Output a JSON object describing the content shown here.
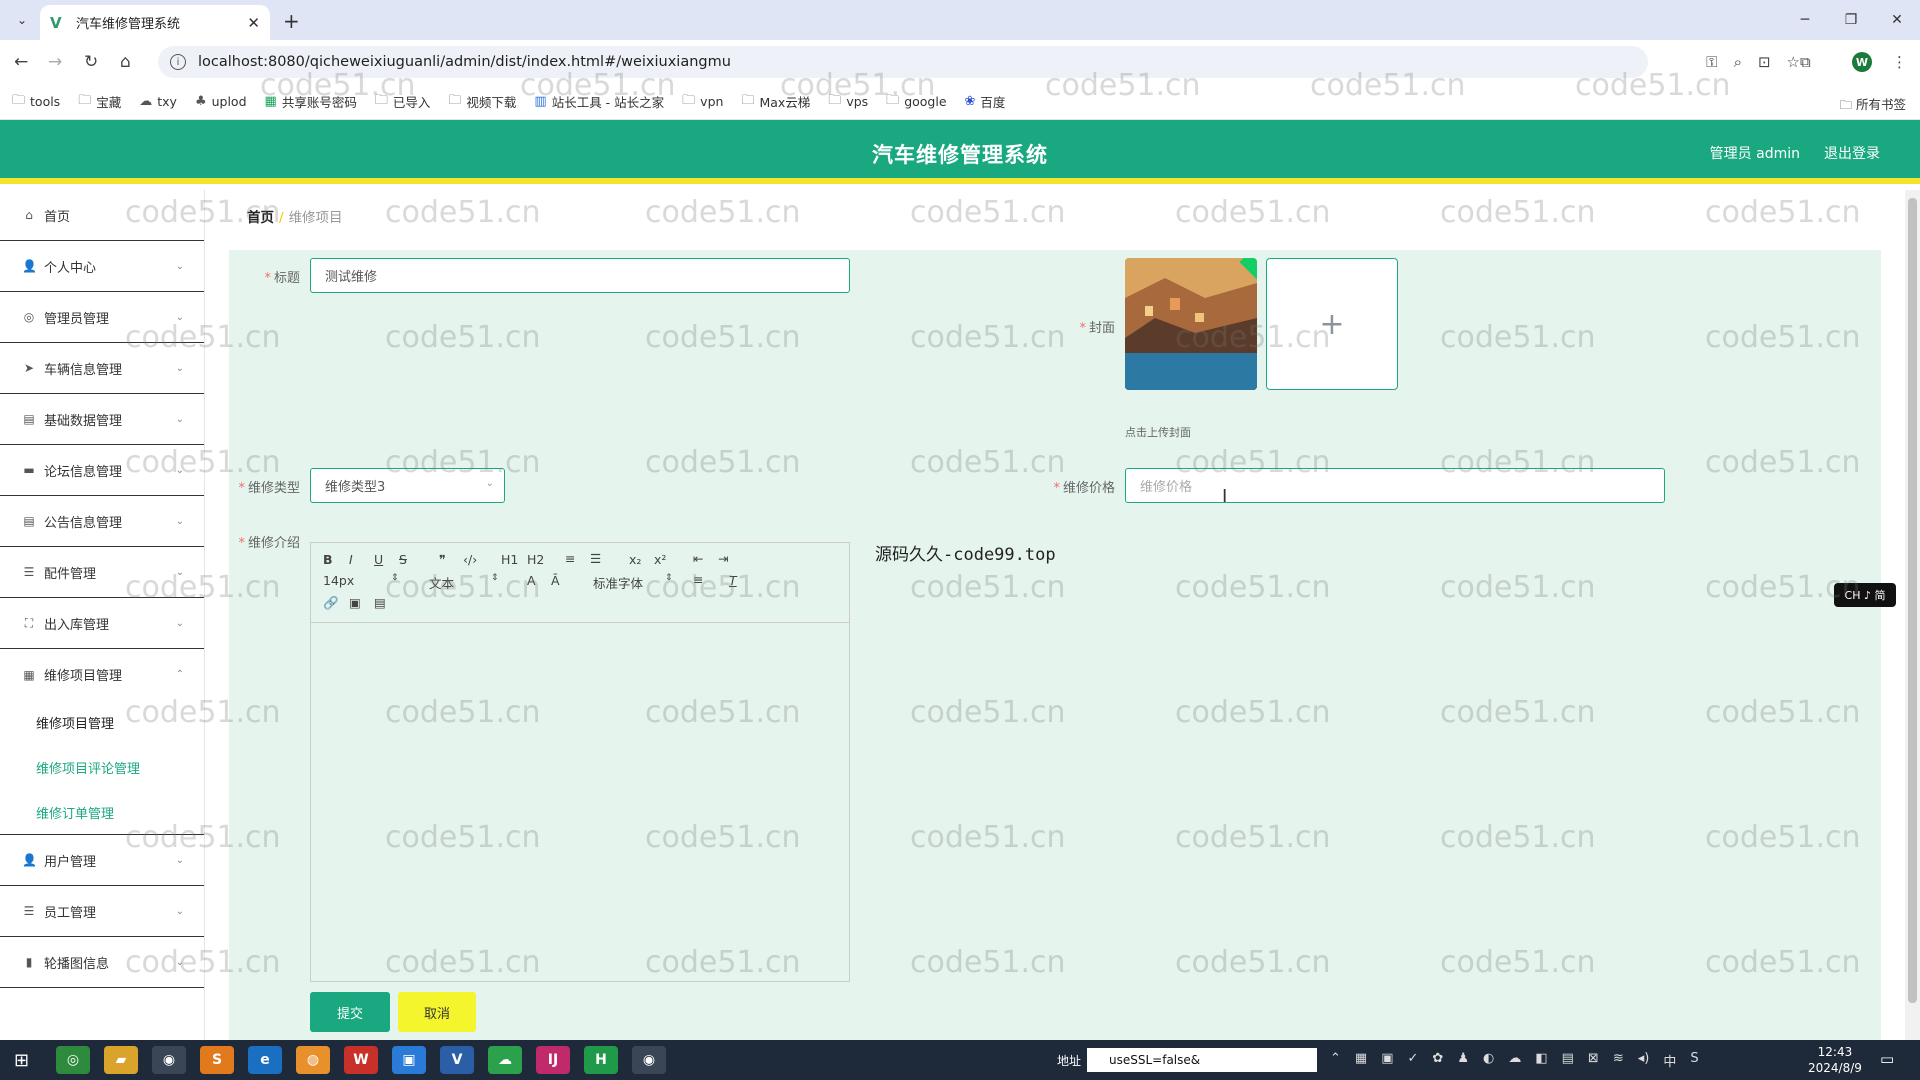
{
  "browser": {
    "tab_title": "汽车维修管理系统",
    "url": "localhost:8080/qicheweixiuguanli/admin/dist/index.html#/weixiuxiangmu",
    "bookmarks": [
      "tools",
      "宝藏",
      "txy",
      "uplod",
      "共享账号密码",
      "已导入",
      "视频下载",
      "站长工具 - 站长之家",
      "vpn",
      "Max云梯",
      "vps",
      "google",
      "百度"
    ],
    "bookmarks_right": "所有书签",
    "profile_initial": "W"
  },
  "header": {
    "title": "汽车维修管理系统",
    "user": "管理员 admin",
    "logout": "退出登录"
  },
  "sidebar": {
    "items": [
      {
        "label": "首页",
        "icon": "home-icon"
      },
      {
        "label": "个人中心",
        "icon": "user-icon"
      },
      {
        "label": "管理员管理",
        "icon": "admin-icon"
      },
      {
        "label": "车辆信息管理",
        "icon": "vehicle-icon"
      },
      {
        "label": "基础数据管理",
        "icon": "data-icon"
      },
      {
        "label": "论坛信息管理",
        "icon": "forum-icon"
      },
      {
        "label": "公告信息管理",
        "icon": "notice-icon"
      },
      {
        "label": "配件管理",
        "icon": "parts-icon"
      },
      {
        "label": "出入库管理",
        "icon": "warehouse-icon"
      },
      {
        "label": "维修项目管理",
        "icon": "repair-icon"
      }
    ],
    "sub_items": [
      "维修项目管理",
      "维修项目评论管理",
      "维修订单管理"
    ],
    "items_after": [
      {
        "label": "用户管理",
        "icon": "user-icon"
      },
      {
        "label": "员工管理",
        "icon": "staff-icon"
      },
      {
        "label": "轮播图信息",
        "icon": "chart-icon"
      }
    ]
  },
  "breadcrumb": {
    "home": "首页",
    "current": "维修项目"
  },
  "form": {
    "title_label": "标题",
    "title_value": "测试维修",
    "cover_label": "封面",
    "upload_tip": "点击上传封面",
    "type_label": "维修类型",
    "type_value": "维修类型3",
    "price_label": "维修价格",
    "price_placeholder": "维修价格",
    "intro_label": "维修介绍",
    "submit": "提交",
    "cancel": "取消"
  },
  "editor": {
    "font_size": "14px",
    "paragraph": "文本",
    "font_family": "标准字体",
    "tools": [
      "B",
      "I",
      "U",
      "S",
      "❞",
      "‹/›",
      "H1",
      "H2"
    ]
  },
  "overlay_text": "源码久久-code99.top",
  "ime_badge": "CH ♪ 简",
  "watermark": "code51.cn",
  "taskbar": {
    "addr_label": "地址",
    "addr_value": "useSSL=false&",
    "time": "12:43",
    "date": "2024/8/9"
  },
  "colors": {
    "primary": "#1aa881",
    "accent": "#f5e22d",
    "form_bg": "#e6f4ee"
  }
}
